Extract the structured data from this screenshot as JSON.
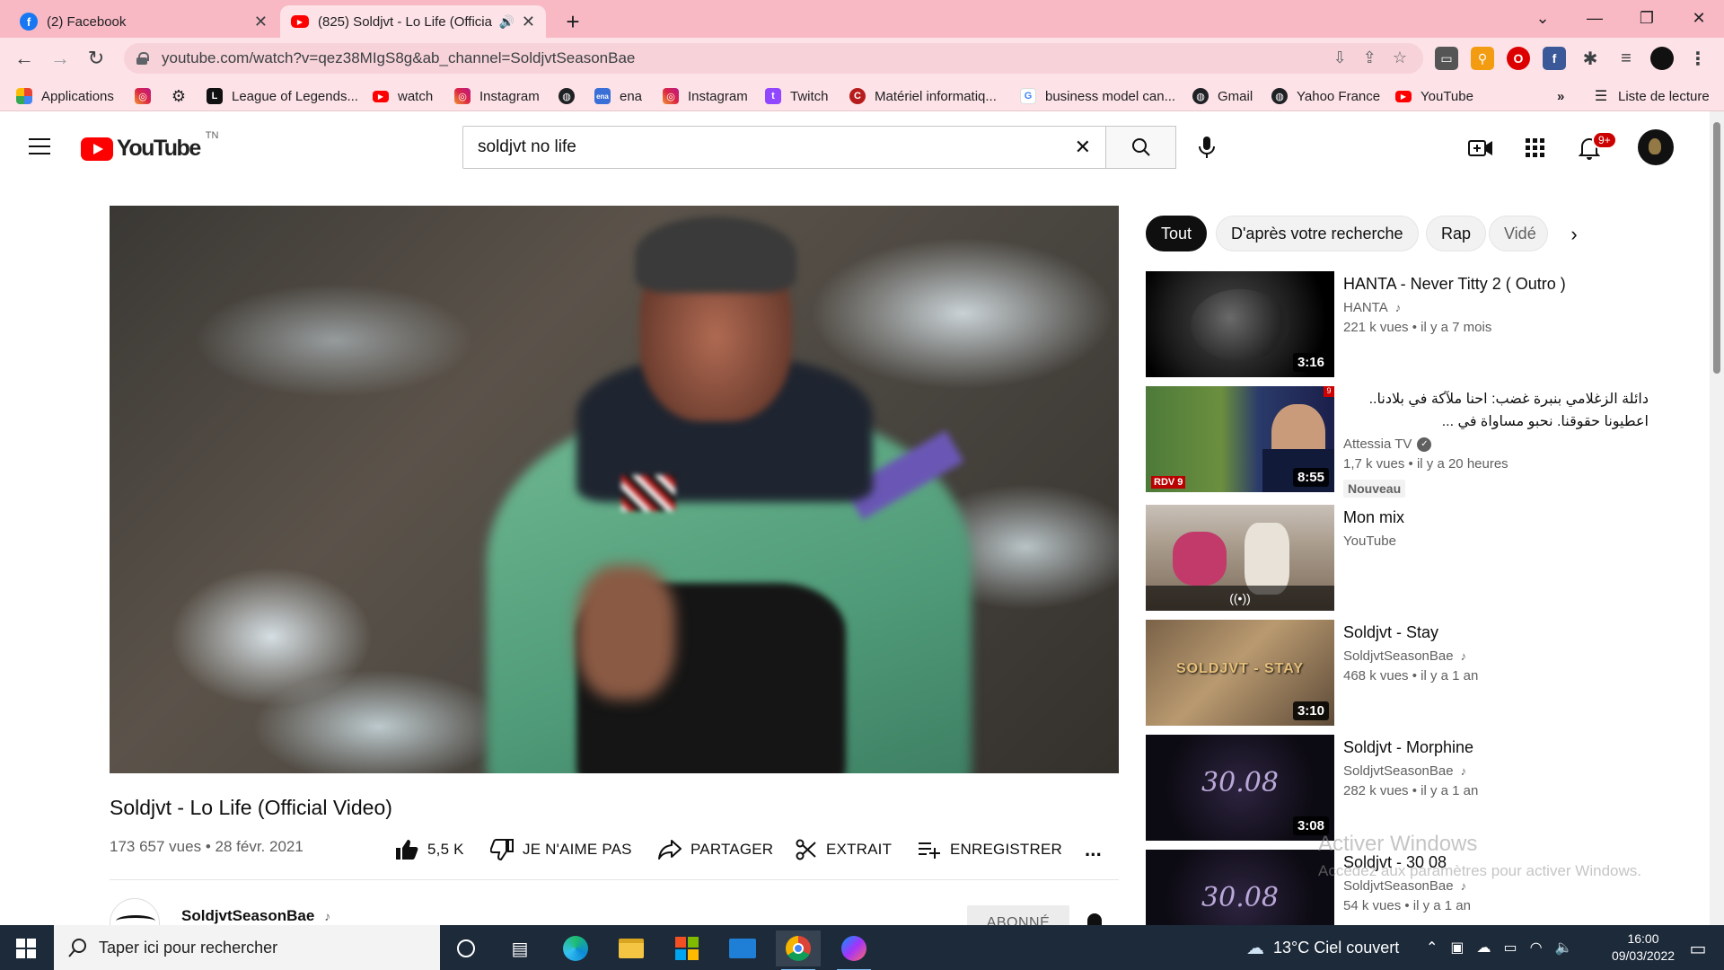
{
  "browser": {
    "tabs": [
      {
        "title": "(2) Facebook",
        "icon": "facebook-icon"
      },
      {
        "title": "(825) Soldjvt - Lo Life (Officia",
        "icon": "youtube-icon"
      }
    ],
    "url": "youtube.com/watch?v=qez38MIgS8g&ab_channel=SoldjvtSeasonBae",
    "bookmarks": [
      {
        "label": "Applications",
        "icon": "apps-grid-icon"
      },
      {
        "label": "",
        "icon": "instagram-icon"
      },
      {
        "label": "",
        "icon": "gear-icon"
      },
      {
        "label": "League of Legends...",
        "icon": "league-icon"
      },
      {
        "label": "watch",
        "icon": "youtube-icon"
      },
      {
        "label": "Instagram",
        "icon": "instagram-icon"
      },
      {
        "label": "",
        "icon": "globe-icon"
      },
      {
        "label": "ena",
        "icon": "ena-icon"
      },
      {
        "label": "Instagram",
        "icon": "instagram-icon"
      },
      {
        "label": "Twitch",
        "icon": "twitch-icon"
      },
      {
        "label": "Matériel informatiq...",
        "icon": "materiel-icon"
      },
      {
        "label": "business model can...",
        "icon": "google-icon"
      },
      {
        "label": "Gmail",
        "icon": "globe-icon"
      },
      {
        "label": "Yahoo France",
        "icon": "globe-icon"
      },
      {
        "label": "YouTube",
        "icon": "youtube-icon"
      }
    ],
    "more": "»",
    "reading_list": "Liste de lecture"
  },
  "youtube": {
    "logo_text": "YouTube",
    "country_code": "TN",
    "search_value": "soldjvt no life",
    "notification_count": "9+",
    "video": {
      "title": "Soldjvt - Lo Life (Official Video)",
      "views": "173 657 vues",
      "date": "28 févr. 2021",
      "likes": "5,5 K",
      "dislike_label": "JE N'AIME PAS",
      "share_label": "PARTAGER",
      "clip_label": "EXTRAIT",
      "save_label": "ENREGISTRER",
      "more": "..."
    },
    "channel": {
      "name": "SoldjvtSeasonBae",
      "subscribe_label": "ABONNÉ"
    },
    "chips": [
      "Tout",
      "D'après votre recherche",
      "Rap",
      "Vidé"
    ],
    "recommendations": [
      {
        "title": "HANTA - Never Titty 2 ( Outro )",
        "channel": "HANTA",
        "stats": "221 k vues • il y a 7 mois",
        "duration": "3:16",
        "music": true
      },
      {
        "title": "دائلة الزغلامي بنبرة غضب: احنا ملآكة في بلادنا.. اعطيونا حقوقنا. نحبو مساواة في ...",
        "channel": "Attessia TV",
        "stats": "1,7 k vues • il y a 20 heures",
        "duration": "8:55",
        "verified": true,
        "badge": "Nouveau"
      },
      {
        "title": "Mon mix",
        "channel": "YouTube",
        "stats": "",
        "duration": ""
      },
      {
        "title": "Soldjvt - Stay",
        "channel": "SoldjvtSeasonBae",
        "stats": "468 k vues • il y a 1 an",
        "duration": "3:10",
        "music": true
      },
      {
        "title": "Soldjvt - Morphine",
        "channel": "SoldjvtSeasonBae",
        "stats": "282 k vues • il y a 1 an",
        "duration": "3:08",
        "music": true
      },
      {
        "title": "Soldjvt - 30 08",
        "channel": "SoldjvtSeasonBae",
        "stats": "54 k vues • il y a 1 an",
        "duration": "",
        "music": true
      }
    ],
    "thumb_texts": {
      "stay": "SOLDJVT - STAY",
      "morphine": "30.08",
      "news_tag": "RDV 9"
    }
  },
  "watermark": {
    "line1": "Activer Windows",
    "line2": "Accédez aux paramètres pour activer Windows."
  },
  "taskbar": {
    "search_placeholder": "Taper ici pour rechercher",
    "weather": "13°C  Ciel couvert",
    "time": "16:00",
    "date": "09/03/2022"
  }
}
